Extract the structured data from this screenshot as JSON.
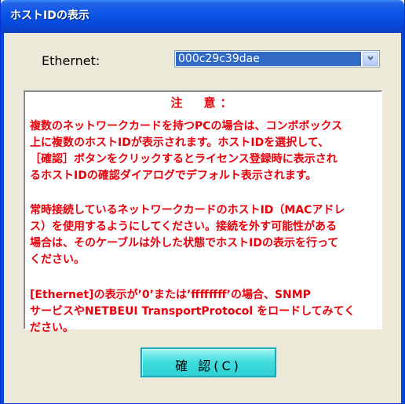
{
  "window": {
    "title": "ホストIDの表示"
  },
  "ethernet": {
    "label": "Ethernet:",
    "selected_value": "000c29c39dae"
  },
  "notice": {
    "title": "注　意：",
    "paragraphs": [
      [
        "複数のネットワークカードを持つPCの場合は、コンボボックス",
        "上に複数のホストIDが表示されます。ホストIDを選択して、",
        "［確認］ボタンをクリックするとライセンス登録時に表示され",
        "るホストIDの確認ダイアログでデフォルト表示されます。"
      ],
      [
        "常時接続しているネットワークカードのホストID（MACアドレ",
        "ス）を使用するようにしてください。接続を外す可能性がある",
        "場合は、そのケーブルは外した状態でホストIDの表示を行って",
        "ください。"
      ],
      [
        "[Ethernet]の表示が’0’または’ffffffff’の場合、SNMP",
        "サービスやNETBEUI TransportProtocol をロードしてみてく",
        "ださい。"
      ]
    ]
  },
  "buttons": {
    "confirm_label": "確 認(C)"
  },
  "colors": {
    "titlebar": "#0a54e6",
    "notice_text": "#e8000b",
    "button": "#3fdcdc",
    "selection": "#316ac5"
  },
  "icons": {
    "dropdown": "chevron-down-icon"
  }
}
